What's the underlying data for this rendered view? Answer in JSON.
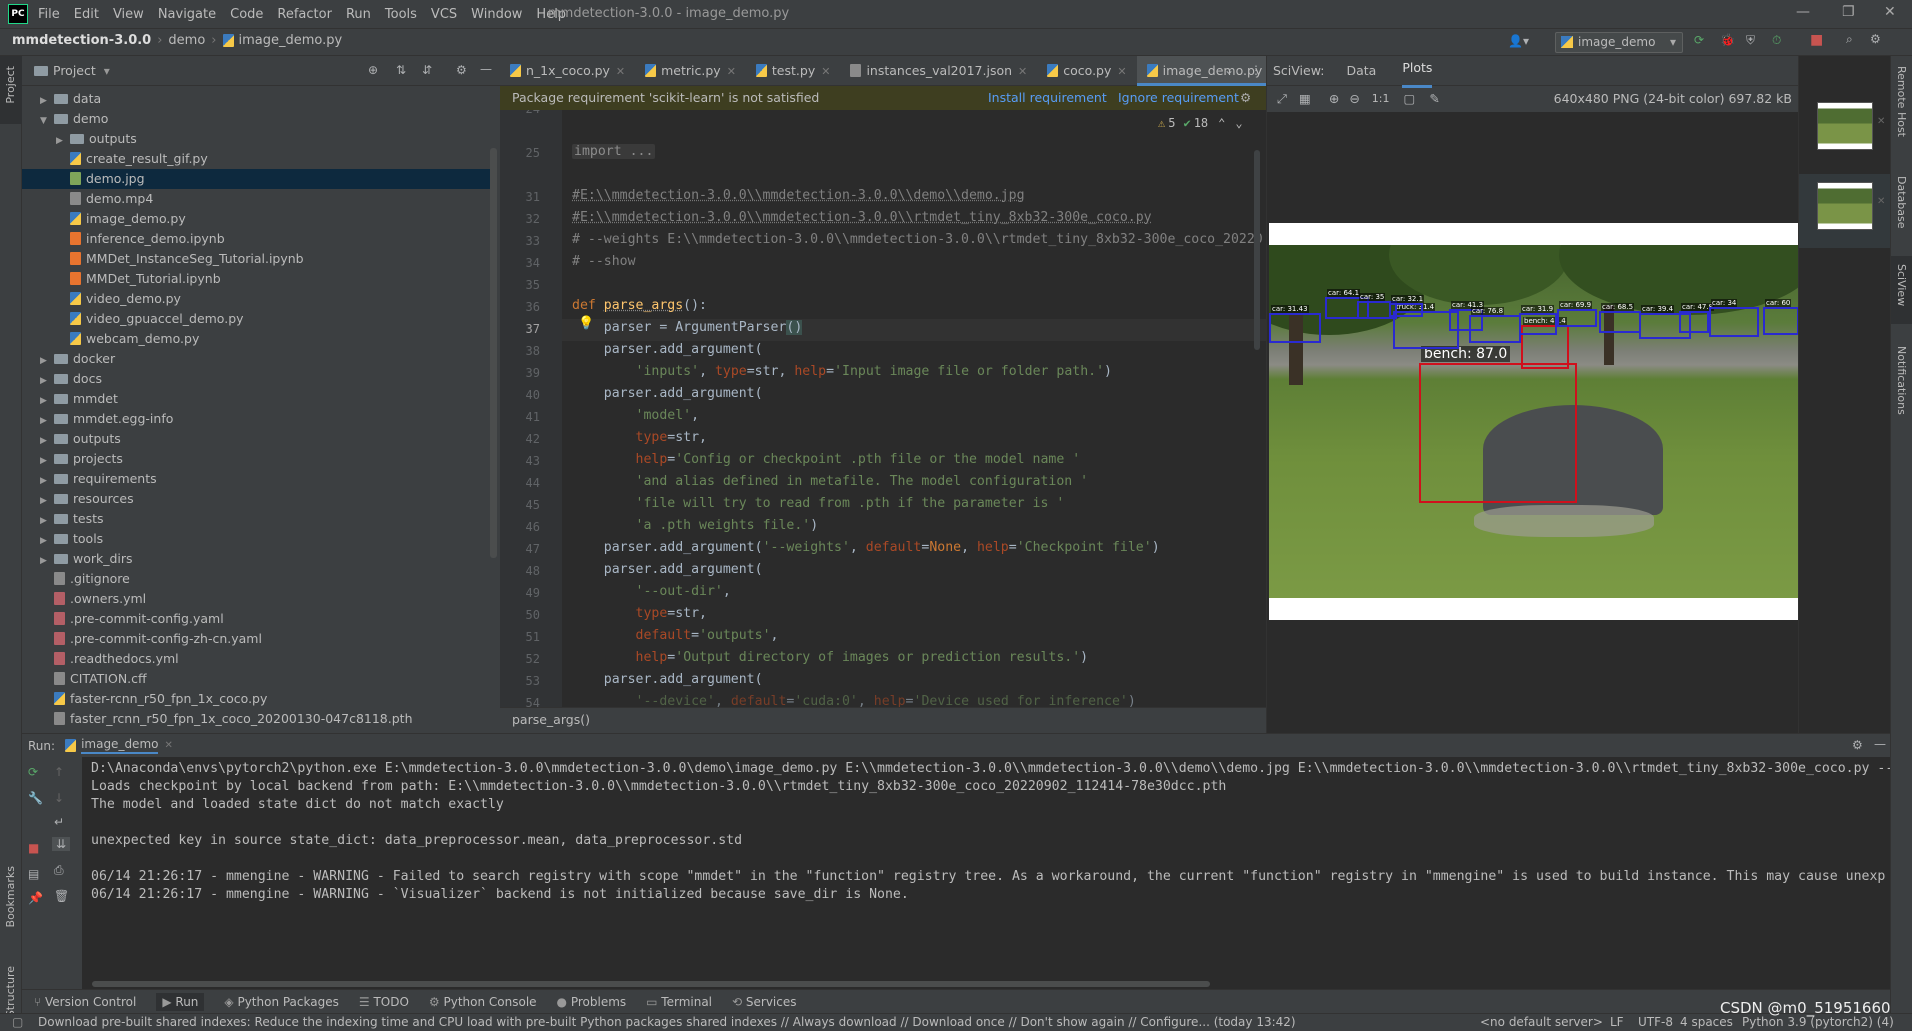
{
  "titlebar": {
    "logo": "PC",
    "menu": [
      "File",
      "Edit",
      "View",
      "Navigate",
      "Code",
      "Refactor",
      "Run",
      "Tools",
      "VCS",
      "Window",
      "Help"
    ],
    "title": "mmdetection-3.0.0 - image_demo.py"
  },
  "navbar": {
    "project": "mmdetection-3.0.0",
    "folder": "demo",
    "file": "image_demo.py",
    "run_config": "image_demo"
  },
  "left_strip": {
    "project_label": "Project",
    "bookmarks_label": "Bookmarks",
    "structure_label": "Structure"
  },
  "project_panel": {
    "title": "Project",
    "items": [
      {
        "label": "data",
        "type": "folder",
        "depth": 1,
        "arrow": "▶"
      },
      {
        "label": "demo",
        "type": "folder",
        "depth": 1,
        "arrow": "▼"
      },
      {
        "label": "outputs",
        "type": "folder",
        "depth": 2,
        "arrow": "▶"
      },
      {
        "label": "create_result_gif.py",
        "type": "py",
        "depth": 2,
        "arrow": ""
      },
      {
        "label": "demo.jpg",
        "type": "img",
        "depth": 2,
        "arrow": "",
        "selected": true
      },
      {
        "label": "demo.mp4",
        "type": "txt",
        "depth": 2,
        "arrow": ""
      },
      {
        "label": "image_demo.py",
        "type": "py",
        "depth": 2,
        "arrow": ""
      },
      {
        "label": "inference_demo.ipynb",
        "type": "nb",
        "depth": 2,
        "arrow": ""
      },
      {
        "label": "MMDet_InstanceSeg_Tutorial.ipynb",
        "type": "nb",
        "depth": 2,
        "arrow": ""
      },
      {
        "label": "MMDet_Tutorial.ipynb",
        "type": "nb",
        "depth": 2,
        "arrow": ""
      },
      {
        "label": "video_demo.py",
        "type": "py",
        "depth": 2,
        "arrow": ""
      },
      {
        "label": "video_gpuaccel_demo.py",
        "type": "py",
        "depth": 2,
        "arrow": ""
      },
      {
        "label": "webcam_demo.py",
        "type": "py",
        "depth": 2,
        "arrow": ""
      },
      {
        "label": "docker",
        "type": "folder",
        "depth": 1,
        "arrow": "▶"
      },
      {
        "label": "docs",
        "type": "folder",
        "depth": 1,
        "arrow": "▶"
      },
      {
        "label": "mmdet",
        "type": "folder",
        "depth": 1,
        "arrow": "▶"
      },
      {
        "label": "mmdet.egg-info",
        "type": "folder",
        "depth": 1,
        "arrow": "▶"
      },
      {
        "label": "outputs",
        "type": "folder",
        "depth": 1,
        "arrow": "▶"
      },
      {
        "label": "projects",
        "type": "folder",
        "depth": 1,
        "arrow": "▶"
      },
      {
        "label": "requirements",
        "type": "folder",
        "depth": 1,
        "arrow": "▶"
      },
      {
        "label": "resources",
        "type": "folder",
        "depth": 1,
        "arrow": "▶"
      },
      {
        "label": "tests",
        "type": "folder",
        "depth": 1,
        "arrow": "▶"
      },
      {
        "label": "tools",
        "type": "folder",
        "depth": 1,
        "arrow": "▶"
      },
      {
        "label": "work_dirs",
        "type": "folder",
        "depth": 1,
        "arrow": "▶"
      },
      {
        "label": ".gitignore",
        "type": "txt",
        "depth": 1,
        "arrow": ""
      },
      {
        "label": ".owners.yml",
        "type": "yml",
        "depth": 1,
        "arrow": ""
      },
      {
        "label": ".pre-commit-config.yaml",
        "type": "yml",
        "depth": 1,
        "arrow": ""
      },
      {
        "label": ".pre-commit-config-zh-cn.yaml",
        "type": "yml",
        "depth": 1,
        "arrow": ""
      },
      {
        "label": ".readthedocs.yml",
        "type": "yml",
        "depth": 1,
        "arrow": ""
      },
      {
        "label": "CITATION.cff",
        "type": "txt",
        "depth": 1,
        "arrow": ""
      },
      {
        "label": "faster-rcnn_r50_fpn_1x_coco.py",
        "type": "py",
        "depth": 1,
        "arrow": ""
      },
      {
        "label": "faster_rcnn_r50_fpn_1x_coco_20200130-047c8118.pth",
        "type": "txt",
        "depth": 1,
        "arrow": ""
      }
    ]
  },
  "editor": {
    "tabs": [
      {
        "label": "n_1x_coco.py",
        "active": false
      },
      {
        "label": "metric.py",
        "active": false
      },
      {
        "label": "test.py",
        "active": false
      },
      {
        "label": "instances_val2017.json",
        "active": false
      },
      {
        "label": "coco.py",
        "active": false
      },
      {
        "label": "image_demo.py",
        "active": true
      }
    ],
    "banner": {
      "message": "Package requirement 'scikit-learn' is not satisfied",
      "install": "Install requirement",
      "ignore": "Ignore requirement"
    },
    "inspections": {
      "warnings": "5",
      "weak_warnings": "18"
    },
    "line_numbers": [
      "24",
      "25",
      "31",
      "32",
      "33",
      "34",
      "35",
      "36",
      "37",
      "38",
      "39",
      "40",
      "41",
      "42",
      "43",
      "44",
      "45",
      "46",
      "47",
      "48",
      "49",
      "50",
      "51",
      "52",
      "53",
      "54"
    ],
    "breadcrumb": "parse_args()"
  },
  "sciview": {
    "title": "SciView:",
    "tab_data": "Data",
    "tab_plots": "Plots",
    "zoom_actual": "1:1",
    "image_info": "640x480 PNG (24-bit color) 697.82 kB",
    "detections": [
      {
        "label": "bench: 87.0",
        "color": "#d0101c"
      },
      {
        "label": "bench: 46.4",
        "color": "#d0101c"
      },
      {
        "label": "truck: 31.4",
        "color": "#2a2ad0"
      },
      {
        "label": "car: 41.3",
        "color": "#2a2ad0"
      },
      {
        "label": "car: 76.8",
        "color": "#2a2ad0"
      },
      {
        "label": "car: 31.9",
        "color": "#2a2ad0"
      },
      {
        "label": "car: 31.43",
        "color": "#2a2ad0"
      },
      {
        "label": "car: 64.1",
        "color": "#2a2ad0"
      },
      {
        "label": "car: 35",
        "color": "#2a2ad0"
      },
      {
        "label": "car: 32.1",
        "color": "#2a2ad0"
      },
      {
        "label": "car: 69.9",
        "color": "#2a2ad0"
      },
      {
        "label": "car: 68.5",
        "color": "#2a2ad0"
      },
      {
        "label": "car: 39.4",
        "color": "#2a2ad0"
      },
      {
        "label": "car: 47.8",
        "color": "#2a2ad0"
      },
      {
        "label": "car: 34",
        "color": "#2a2ad0"
      },
      {
        "label": "car: 60",
        "color": "#2a2ad0"
      }
    ]
  },
  "right_strip": {
    "remote_host": "Remote Host",
    "database": "Database",
    "sciview": "SciView",
    "notifications": "Notifications"
  },
  "run_panel": {
    "label": "Run:",
    "tab": "image_demo",
    "lines": [
      "D:\\Anaconda\\envs\\pytorch2\\python.exe E:\\mmdetection-3.0.0\\mmdetection-3.0.0\\demo\\image_demo.py E:\\\\mmdetection-3.0.0\\\\mmdetection-3.0.0\\\\demo\\\\demo.jpg E:\\\\mmdetection-3.0.0\\\\mmdetection-3.0.0\\\\rtmdet_tiny_8xb32-300e_coco.py --",
      "Loads checkpoint by local backend from path: E:\\\\mmdetection-3.0.0\\\\mmdetection-3.0.0\\\\rtmdet_tiny_8xb32-300e_coco_20220902_112414-78e30dcc.pth",
      "The model and loaded state dict do not match exactly",
      "",
      "unexpected key in source state_dict: data_preprocessor.mean, data_preprocessor.std",
      "",
      "06/14 21:26:17 - mmengine - WARNING - Failed to search registry with scope \"mmdet\" in the \"function\" registry tree. As a workaround, the current \"function\" registry in \"mmengine\" is used to build instance. This may cause unexp",
      "06/14 21:26:17 - mmengine - WARNING - `Visualizer` backend is not initialized because save_dir is None."
    ]
  },
  "tool_tabs": [
    "Version Control",
    "Run",
    "Python Packages",
    "TODO",
    "Python Console",
    "Problems",
    "Terminal",
    "Services"
  ],
  "status_bar": {
    "message": "Download pre-built shared indexes: Reduce the indexing time and CPU load with pre-built Python packages shared indexes // Always download // Download once // Don't show again // Configure... (today 13:42)",
    "server": "<no default server>",
    "line_sep": "LF",
    "encoding": "UTF-8",
    "indent": "4 spaces",
    "interpreter": "Python 3.9 (pytorch2) (4)",
    "watermark": "CSDN @m0_51951660"
  }
}
